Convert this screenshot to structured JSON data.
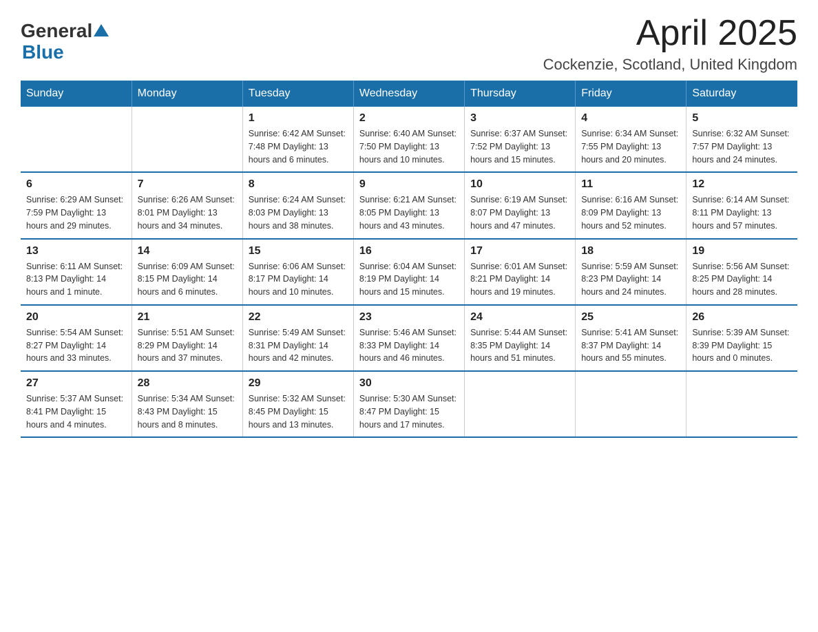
{
  "header": {
    "logo_general": "General",
    "logo_blue": "Blue",
    "title": "April 2025",
    "subtitle": "Cockenzie, Scotland, United Kingdom"
  },
  "calendar": {
    "days_of_week": [
      "Sunday",
      "Monday",
      "Tuesday",
      "Wednesday",
      "Thursday",
      "Friday",
      "Saturday"
    ],
    "weeks": [
      [
        {
          "day": "",
          "info": ""
        },
        {
          "day": "",
          "info": ""
        },
        {
          "day": "1",
          "info": "Sunrise: 6:42 AM\nSunset: 7:48 PM\nDaylight: 13 hours\nand 6 minutes."
        },
        {
          "day": "2",
          "info": "Sunrise: 6:40 AM\nSunset: 7:50 PM\nDaylight: 13 hours\nand 10 minutes."
        },
        {
          "day": "3",
          "info": "Sunrise: 6:37 AM\nSunset: 7:52 PM\nDaylight: 13 hours\nand 15 minutes."
        },
        {
          "day": "4",
          "info": "Sunrise: 6:34 AM\nSunset: 7:55 PM\nDaylight: 13 hours\nand 20 minutes."
        },
        {
          "day": "5",
          "info": "Sunrise: 6:32 AM\nSunset: 7:57 PM\nDaylight: 13 hours\nand 24 minutes."
        }
      ],
      [
        {
          "day": "6",
          "info": "Sunrise: 6:29 AM\nSunset: 7:59 PM\nDaylight: 13 hours\nand 29 minutes."
        },
        {
          "day": "7",
          "info": "Sunrise: 6:26 AM\nSunset: 8:01 PM\nDaylight: 13 hours\nand 34 minutes."
        },
        {
          "day": "8",
          "info": "Sunrise: 6:24 AM\nSunset: 8:03 PM\nDaylight: 13 hours\nand 38 minutes."
        },
        {
          "day": "9",
          "info": "Sunrise: 6:21 AM\nSunset: 8:05 PM\nDaylight: 13 hours\nand 43 minutes."
        },
        {
          "day": "10",
          "info": "Sunrise: 6:19 AM\nSunset: 8:07 PM\nDaylight: 13 hours\nand 47 minutes."
        },
        {
          "day": "11",
          "info": "Sunrise: 6:16 AM\nSunset: 8:09 PM\nDaylight: 13 hours\nand 52 minutes."
        },
        {
          "day": "12",
          "info": "Sunrise: 6:14 AM\nSunset: 8:11 PM\nDaylight: 13 hours\nand 57 minutes."
        }
      ],
      [
        {
          "day": "13",
          "info": "Sunrise: 6:11 AM\nSunset: 8:13 PM\nDaylight: 14 hours\nand 1 minute."
        },
        {
          "day": "14",
          "info": "Sunrise: 6:09 AM\nSunset: 8:15 PM\nDaylight: 14 hours\nand 6 minutes."
        },
        {
          "day": "15",
          "info": "Sunrise: 6:06 AM\nSunset: 8:17 PM\nDaylight: 14 hours\nand 10 minutes."
        },
        {
          "day": "16",
          "info": "Sunrise: 6:04 AM\nSunset: 8:19 PM\nDaylight: 14 hours\nand 15 minutes."
        },
        {
          "day": "17",
          "info": "Sunrise: 6:01 AM\nSunset: 8:21 PM\nDaylight: 14 hours\nand 19 minutes."
        },
        {
          "day": "18",
          "info": "Sunrise: 5:59 AM\nSunset: 8:23 PM\nDaylight: 14 hours\nand 24 minutes."
        },
        {
          "day": "19",
          "info": "Sunrise: 5:56 AM\nSunset: 8:25 PM\nDaylight: 14 hours\nand 28 minutes."
        }
      ],
      [
        {
          "day": "20",
          "info": "Sunrise: 5:54 AM\nSunset: 8:27 PM\nDaylight: 14 hours\nand 33 minutes."
        },
        {
          "day": "21",
          "info": "Sunrise: 5:51 AM\nSunset: 8:29 PM\nDaylight: 14 hours\nand 37 minutes."
        },
        {
          "day": "22",
          "info": "Sunrise: 5:49 AM\nSunset: 8:31 PM\nDaylight: 14 hours\nand 42 minutes."
        },
        {
          "day": "23",
          "info": "Sunrise: 5:46 AM\nSunset: 8:33 PM\nDaylight: 14 hours\nand 46 minutes."
        },
        {
          "day": "24",
          "info": "Sunrise: 5:44 AM\nSunset: 8:35 PM\nDaylight: 14 hours\nand 51 minutes."
        },
        {
          "day": "25",
          "info": "Sunrise: 5:41 AM\nSunset: 8:37 PM\nDaylight: 14 hours\nand 55 minutes."
        },
        {
          "day": "26",
          "info": "Sunrise: 5:39 AM\nSunset: 8:39 PM\nDaylight: 15 hours\nand 0 minutes."
        }
      ],
      [
        {
          "day": "27",
          "info": "Sunrise: 5:37 AM\nSunset: 8:41 PM\nDaylight: 15 hours\nand 4 minutes."
        },
        {
          "day": "28",
          "info": "Sunrise: 5:34 AM\nSunset: 8:43 PM\nDaylight: 15 hours\nand 8 minutes."
        },
        {
          "day": "29",
          "info": "Sunrise: 5:32 AM\nSunset: 8:45 PM\nDaylight: 15 hours\nand 13 minutes."
        },
        {
          "day": "30",
          "info": "Sunrise: 5:30 AM\nSunset: 8:47 PM\nDaylight: 15 hours\nand 17 minutes."
        },
        {
          "day": "",
          "info": ""
        },
        {
          "day": "",
          "info": ""
        },
        {
          "day": "",
          "info": ""
        }
      ]
    ]
  }
}
